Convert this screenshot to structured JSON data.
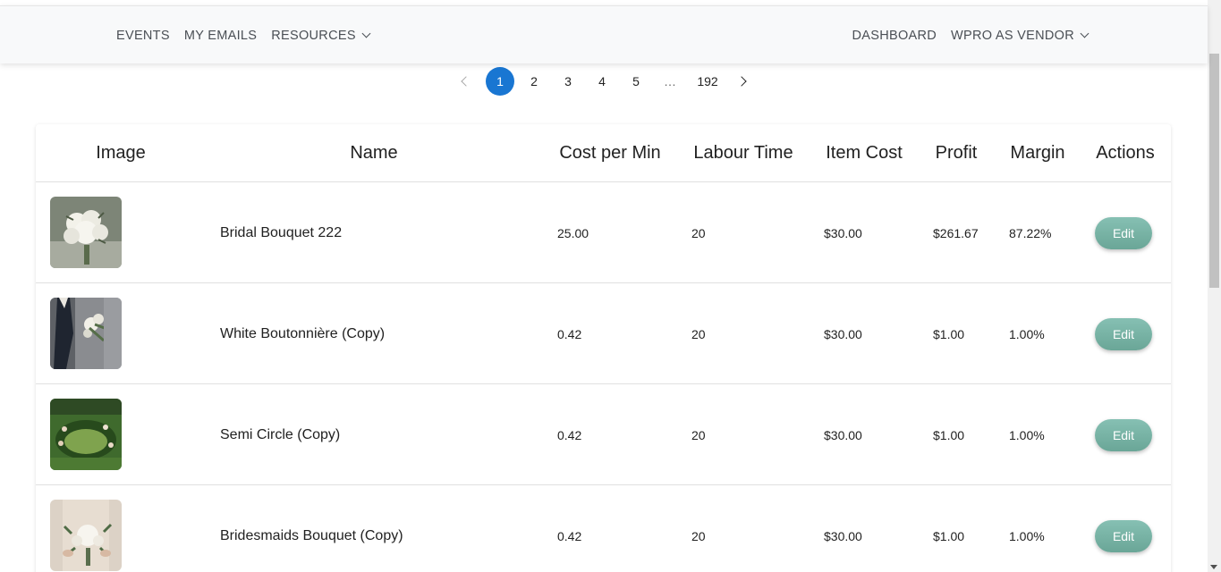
{
  "nav": {
    "left": [
      {
        "label": "EVENTS"
      },
      {
        "label": "MY EMAILS"
      },
      {
        "label": "RESOURCES",
        "dropdown": true
      }
    ],
    "right": [
      {
        "label": "DASHBOARD"
      },
      {
        "label": "WPRO AS VENDOR",
        "dropdown": true
      }
    ]
  },
  "pagination": {
    "pages": [
      "1",
      "2",
      "3",
      "4",
      "5"
    ],
    "ellipsis": "…",
    "last": "192",
    "current": "1"
  },
  "table": {
    "headers": [
      "Image",
      "Name",
      "Cost per Min",
      "Labour Time",
      "Item Cost",
      "Profit",
      "Margin",
      "Actions"
    ],
    "rows": [
      {
        "image": "bridal-bouquet-photo",
        "name": "Bridal Bouquet 222",
        "cost_per_min": "25.00",
        "labour_time": "20",
        "item_cost": "$30.00",
        "profit": "$261.67",
        "margin": "87.22%",
        "action": "Edit"
      },
      {
        "image": "boutonniere-photo",
        "name": "White Boutonnière (Copy)",
        "cost_per_min": "0.42",
        "labour_time": "20",
        "item_cost": "$30.00",
        "profit": "$1.00",
        "margin": "1.00%",
        "action": "Edit"
      },
      {
        "image": "semi-circle-photo",
        "name": "Semi Circle (Copy)",
        "cost_per_min": "0.42",
        "labour_time": "20",
        "item_cost": "$30.00",
        "profit": "$1.00",
        "margin": "1.00%",
        "action": "Edit"
      },
      {
        "image": "bridesmaids-bouquet-photo",
        "name": "Bridesmaids Bouquet (Copy)",
        "cost_per_min": "0.42",
        "labour_time": "20",
        "item_cost": "$30.00",
        "profit": "$1.00",
        "margin": "1.00%",
        "action": "Edit"
      }
    ]
  },
  "colors": {
    "accent": "#1976d2",
    "edit_button": "#79b3a5",
    "nav_bg": "#f8f9fa"
  }
}
